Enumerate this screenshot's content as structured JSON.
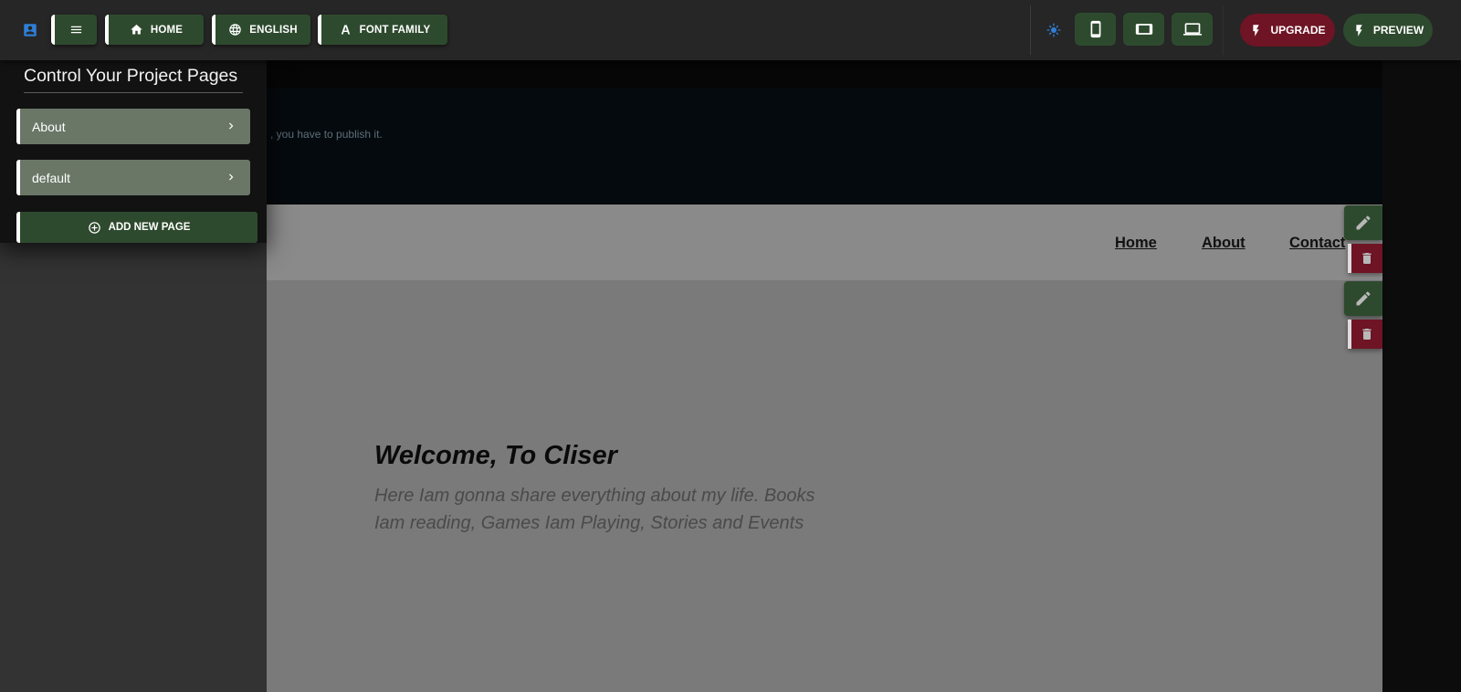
{
  "toolbar": {
    "home_label": "HOME",
    "language_label": "ENGLISH",
    "font_family_label": "FONT FAMILY",
    "upgrade_label": "UPGRADE",
    "preview_label": "PREVIEW"
  },
  "colors": {
    "accent_green": "#2e4a2e",
    "accent_red": "#6e1424",
    "accent_blue": "#2e7fd6"
  },
  "pages_panel": {
    "title": "Control Your Project Pages",
    "pages": [
      {
        "label": "About"
      },
      {
        "label": "default"
      }
    ],
    "add_label": "ADD NEW PAGE"
  },
  "canvas": {
    "notice_text": ", you have to publish it.",
    "nav": {
      "links": [
        "Home",
        "About",
        "Contact"
      ]
    },
    "hero": {
      "title": "Welcome, To Cliser",
      "subtitle": "Here Iam gonna share everything about my life. Books Iam reading, Games Iam Playing, Stories and Events"
    }
  }
}
